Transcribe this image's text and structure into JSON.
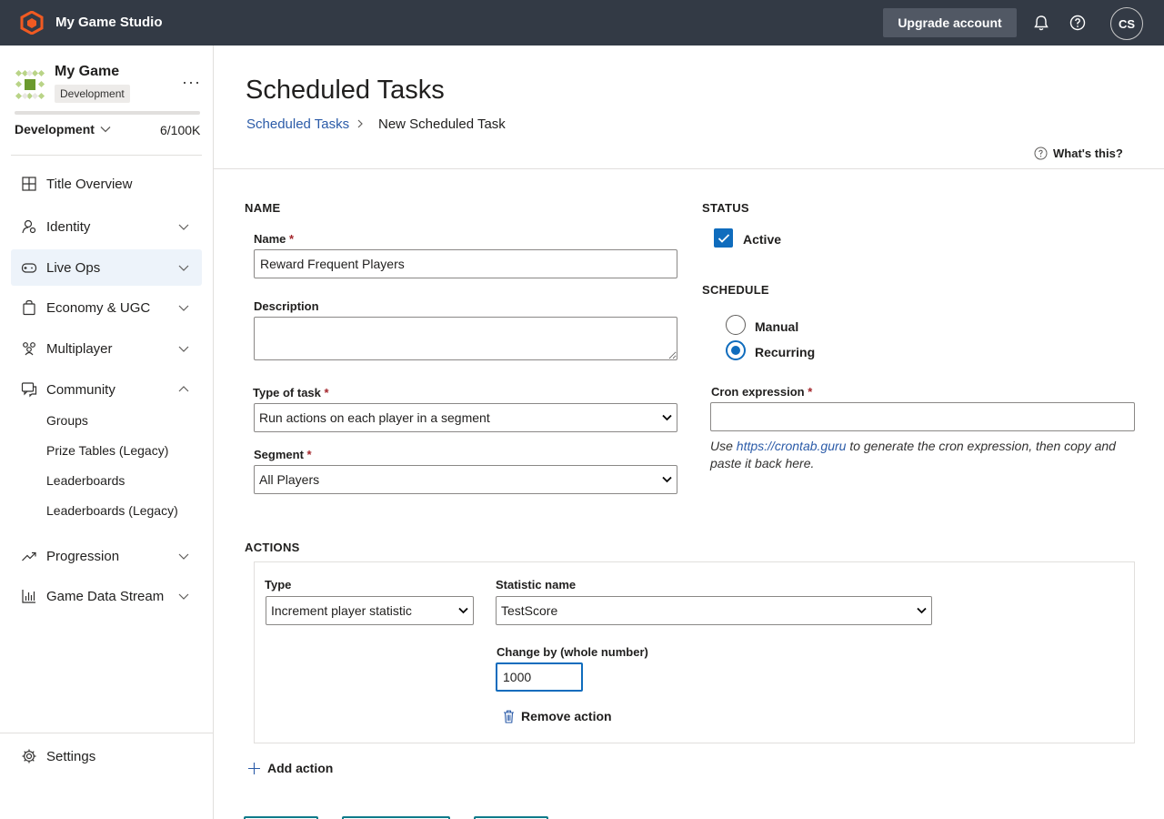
{
  "topbar": {
    "studio_name": "My Game Studio",
    "upgrade_label": "Upgrade account",
    "avatar_initials": "CS",
    "icons": [
      "logo-icon",
      "bell-icon",
      "help-icon"
    ]
  },
  "sidebar": {
    "game_name": "My Game",
    "environment_badge": "Development",
    "environment_select": "Development",
    "usage": "6/100K",
    "nav": [
      {
        "label": "Title Overview",
        "icon": "grid-icon",
        "chevron": "none"
      },
      {
        "label": "Identity",
        "icon": "identity-icon",
        "chevron": "down"
      },
      {
        "label": "Live Ops",
        "icon": "gamepad-icon",
        "chevron": "down",
        "selected": true
      },
      {
        "label": "Economy & UGC",
        "icon": "shopping-bag-icon",
        "chevron": "down"
      },
      {
        "label": "Multiplayer",
        "icon": "people-icon",
        "chevron": "down"
      },
      {
        "label": "Community",
        "icon": "chat-icon",
        "chevron": "up"
      },
      {
        "label": "Progression",
        "icon": "trend-icon",
        "chevron": "down"
      },
      {
        "label": "Game Data Stream",
        "icon": "bar-chart-icon",
        "chevron": "down"
      }
    ],
    "community_sub": [
      "Groups",
      "Prize Tables (Legacy)",
      "Leaderboards",
      "Leaderboards (Legacy)"
    ],
    "settings_label": "Settings"
  },
  "page": {
    "title": "Scheduled Tasks",
    "breadcrumb_link": "Scheduled Tasks",
    "breadcrumb_current": "New Scheduled Task",
    "whats_this": "What's this?"
  },
  "form": {
    "name_section": "NAME",
    "name_label": "Name",
    "name_value": "Reward Frequent Players",
    "description_label": "Description",
    "description_value": "",
    "type_label": "Type of task",
    "type_value": "Run actions on each player in a segment",
    "segment_label": "Segment",
    "segment_value": "All Players",
    "required_mark": "*",
    "status_section": "STATUS",
    "active_label": "Active",
    "active_checked": true,
    "schedule_section": "SCHEDULE",
    "manual_label": "Manual",
    "recurring_label": "Recurring",
    "schedule_selected": "Recurring",
    "cron_label": "Cron expression",
    "cron_value": "",
    "cron_help_prefix": "Use ",
    "cron_help_link": "https://crontab.guru",
    "cron_help_suffix": " to generate the cron expression, then copy and paste it back here."
  },
  "actions": {
    "section": "ACTIONS",
    "type_label": "Type",
    "type_value": "Increment player statistic",
    "stat_label": "Statistic name",
    "stat_value": "TestScore",
    "change_label": "Change by (whole number)",
    "change_value": "1000",
    "remove_label": "Remove action",
    "add_label": "Add action"
  },
  "colors": {
    "topbar_bg": "#333a45",
    "accent": "#0f6cbd",
    "link": "#2b5ba8",
    "logo_orange": "#f05a22",
    "game_icon_green": "#8cb43c"
  }
}
